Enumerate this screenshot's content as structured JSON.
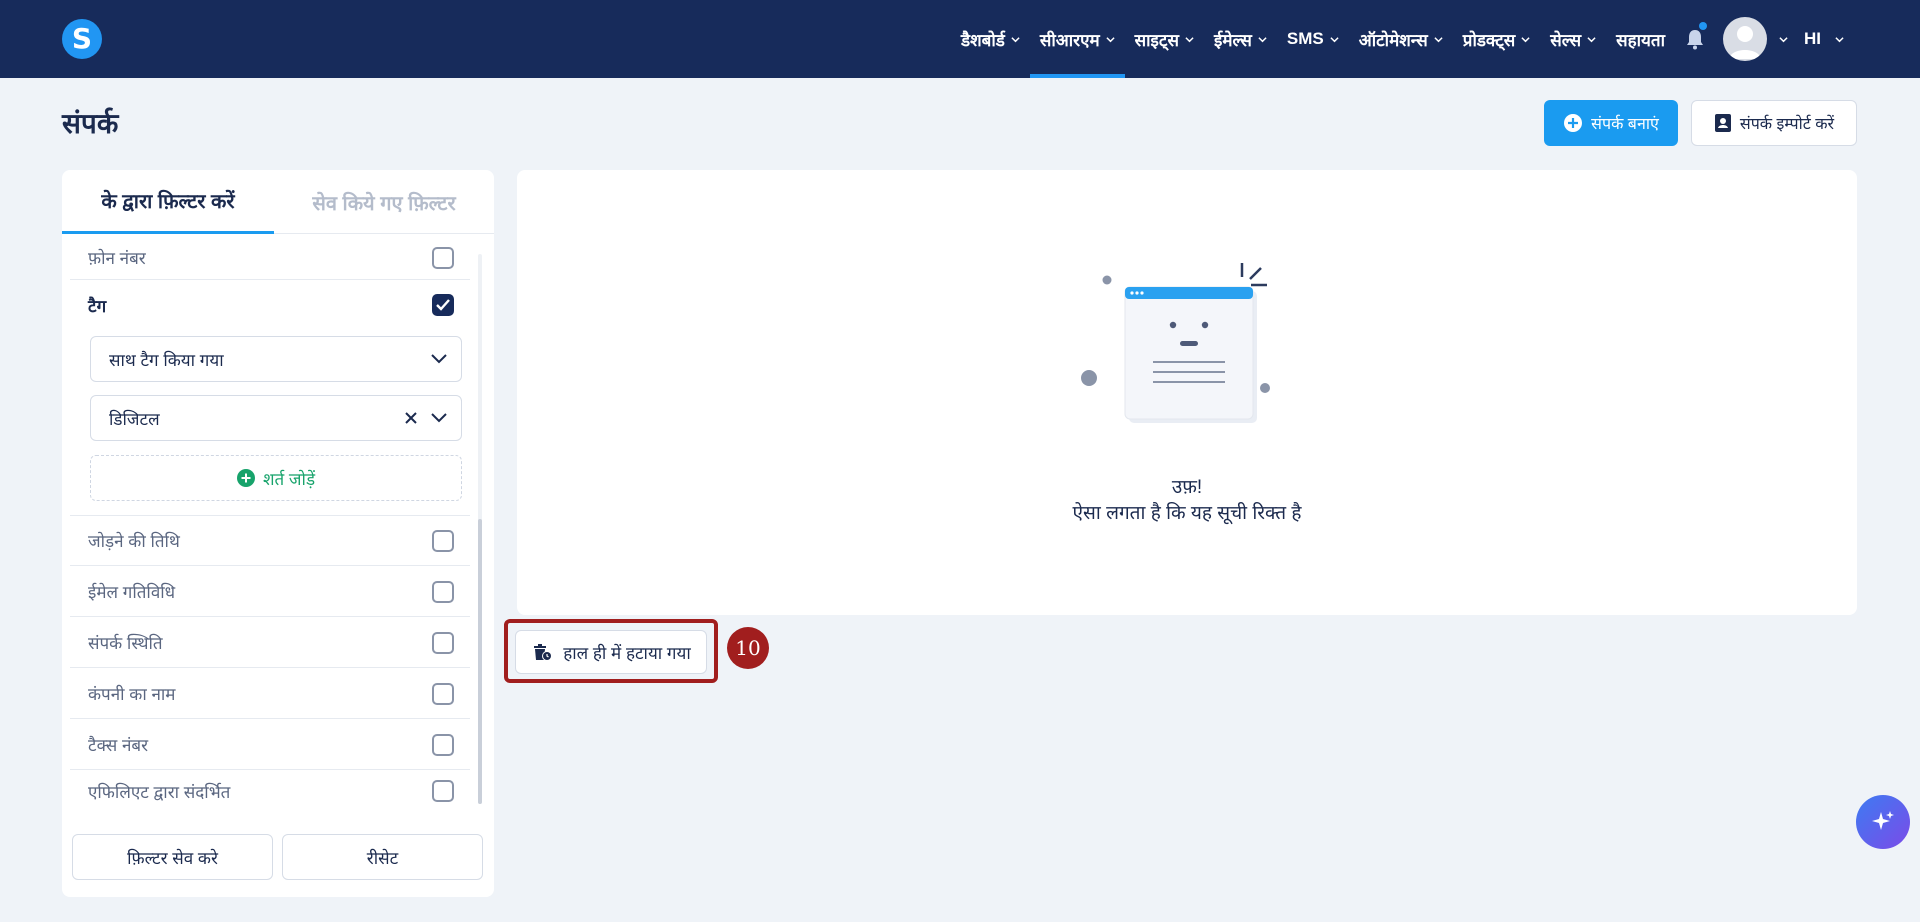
{
  "nav": {
    "logo_letter": "S",
    "items": [
      {
        "label": "डैशबोर्ड",
        "active": false
      },
      {
        "label": "सीआरएम",
        "active": true
      },
      {
        "label": "साइट्स",
        "active": false
      },
      {
        "label": "ईमेल्स",
        "active": false
      },
      {
        "label": "SMS",
        "active": false
      },
      {
        "label": "ऑटोमेशन्स",
        "active": false
      },
      {
        "label": "प्रोडक्ट्स",
        "active": false
      },
      {
        "label": "सेल्स",
        "active": false
      }
    ],
    "help_label": "सहायता",
    "language": "HI",
    "accent_color": "#2196f3",
    "bg_color": "#172b5b"
  },
  "header": {
    "title": "संपर्क",
    "create_button": "संपर्क बनाएं",
    "import_button": "संपर्क इम्पोर्ट करें"
  },
  "filters": {
    "tab_filter_by": "के द्वारा फ़िल्टर करें",
    "tab_saved": "सेव किये गए फ़िल्टर",
    "phone_number": "फ़ोन नंबर",
    "tag": "टैग",
    "tag_condition": "साथ टैग किया गया",
    "tag_value": "डिजिटल",
    "add_condition": "शर्त जोड़ें",
    "rows": [
      "जोड़ने की तिथि",
      "ईमेल गतिविधि",
      "संपर्क स्थिति",
      "कंपनी का नाम",
      "टैक्स नंबर",
      "एफिलिएट द्वारा संदर्भित"
    ],
    "save_filter": "फ़िल्टर सेव करे",
    "reset": "रीसेट"
  },
  "empty_state": {
    "line1": "उफ़!",
    "line2": "ऐसा लगता है कि यह सूची रिक्त है"
  },
  "recently_deleted": "हाल ही में हटाया गया",
  "step_number": "10"
}
